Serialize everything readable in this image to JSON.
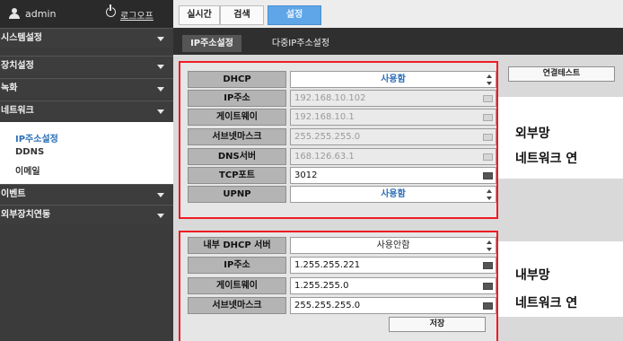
{
  "user": {
    "name": "admin",
    "logout_label": "로그오프"
  },
  "sidebar": {
    "menus": [
      "시스템설정",
      "장치설정",
      "녹화",
      "네트워크"
    ],
    "network_sub": [
      "IP주소설정",
      "DDNS",
      "이메일"
    ],
    "menus_after": [
      "이벤트",
      "외부장치연동"
    ]
  },
  "top_tabs": [
    "실시간",
    "검색",
    "설정"
  ],
  "sub_tabs": [
    "IP주소설정",
    "다중IP주소설정"
  ],
  "external": {
    "rows": [
      {
        "label": "DHCP",
        "value": "사용함"
      },
      {
        "label": "IP주소",
        "value": "192.168.10.102"
      },
      {
        "label": "게이트웨이",
        "value": "192.168.10.1"
      },
      {
        "label": "서브넷마스크",
        "value": "255.255.255.0"
      },
      {
        "label": "DNS서버",
        "value": "168.126.63.1"
      },
      {
        "label": "TCP포트",
        "value": "3012"
      },
      {
        "label": "UPNP",
        "value": "사용함"
      }
    ],
    "connect_test_label": "연결테스트",
    "note_line1": "외부망",
    "note_line2": "네트워크 연"
  },
  "internal": {
    "rows": [
      {
        "label": "내부 DHCP 서버",
        "value": "사용안함"
      },
      {
        "label": "IP주소",
        "value": "1.255.255.221"
      },
      {
        "label": "게이트웨이",
        "value": "1.255.255.0"
      },
      {
        "label": "서브넷마스크",
        "value": "255.255.255.0"
      }
    ],
    "save_label": "저장",
    "note_line1": "내부망",
    "note_line2": "네트워크 연"
  },
  "colors": {
    "accent_tab": "#5fa6e8",
    "highlight_border": "#ee1c24",
    "active_link": "#2d6fb8"
  }
}
